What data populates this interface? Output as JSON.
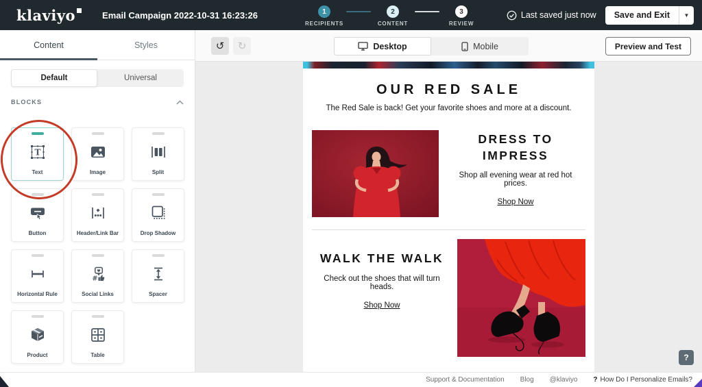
{
  "topbar": {
    "logo": "klaviyo",
    "title": "Email Campaign 2022-10-31 16:23:26",
    "steps": [
      {
        "number": "1",
        "label": "RECIPIENTS"
      },
      {
        "number": "2",
        "label": "CONTENT"
      },
      {
        "number": "3",
        "label": "REVIEW"
      }
    ],
    "saved_status": "Last saved just now",
    "save_button": "Save and Exit"
  },
  "sidebar": {
    "tabs": [
      {
        "label": "Content",
        "active": true
      },
      {
        "label": "Styles",
        "active": false
      }
    ],
    "mode": [
      {
        "label": "Default",
        "selected": true
      },
      {
        "label": "Universal",
        "selected": false
      }
    ],
    "blocks_header": "BLOCKS",
    "blocks": [
      {
        "label": "Text",
        "icon": "text-icon",
        "highlighted": true
      },
      {
        "label": "Image",
        "icon": "image-icon"
      },
      {
        "label": "Split",
        "icon": "split-icon"
      },
      {
        "label": "Button",
        "icon": "button-icon"
      },
      {
        "label": "Header/Link Bar",
        "icon": "header-link-bar-icon"
      },
      {
        "label": "Drop Shadow",
        "icon": "drop-shadow-icon"
      },
      {
        "label": "Horizontal Rule",
        "icon": "horizontal-rule-icon"
      },
      {
        "label": "Social Links",
        "icon": "social-links-icon"
      },
      {
        "label": "Spacer",
        "icon": "spacer-icon"
      },
      {
        "label": "Product",
        "icon": "product-icon"
      },
      {
        "label": "Table",
        "icon": "table-icon"
      }
    ]
  },
  "toolbar": {
    "view": [
      {
        "label": "Desktop",
        "icon": "desktop-icon",
        "selected": true
      },
      {
        "label": "Mobile",
        "icon": "mobile-icon",
        "selected": false
      }
    ],
    "preview_button": "Preview and Test"
  },
  "email": {
    "heading": "OUR RED SALE",
    "subheading": "The Red Sale is back! Get your favorite shoes and more at a discount.",
    "sections": [
      {
        "title": "DRESS TO IMPRESS",
        "body": "Shop all evening wear at red hot prices.",
        "cta": "Shop Now",
        "image": "woman-in-red-dress",
        "image_side": "left"
      },
      {
        "title": "WALK THE WALK",
        "body": "Check out the shoes that will turn heads.",
        "cta": "Shop Now",
        "image": "red-skirt-black-boots",
        "image_side": "right"
      }
    ]
  },
  "footer": {
    "links": [
      "Support & Documentation",
      "Blog",
      "@klaviyo"
    ],
    "help_q": "?",
    "help_link": "How Do I Personalize Emails?",
    "help_button": "?"
  },
  "colors": {
    "topbar_bg": "#20292e",
    "step_active": "#3e92a8",
    "accent_teal": "#3fae9f",
    "annotation_red": "#c43b26",
    "email_image1_bg": "#8e1b28",
    "email_image2_bg": "#b01e3c",
    "skirt_red": "#e8250f",
    "dress_red": "#d2242c"
  }
}
